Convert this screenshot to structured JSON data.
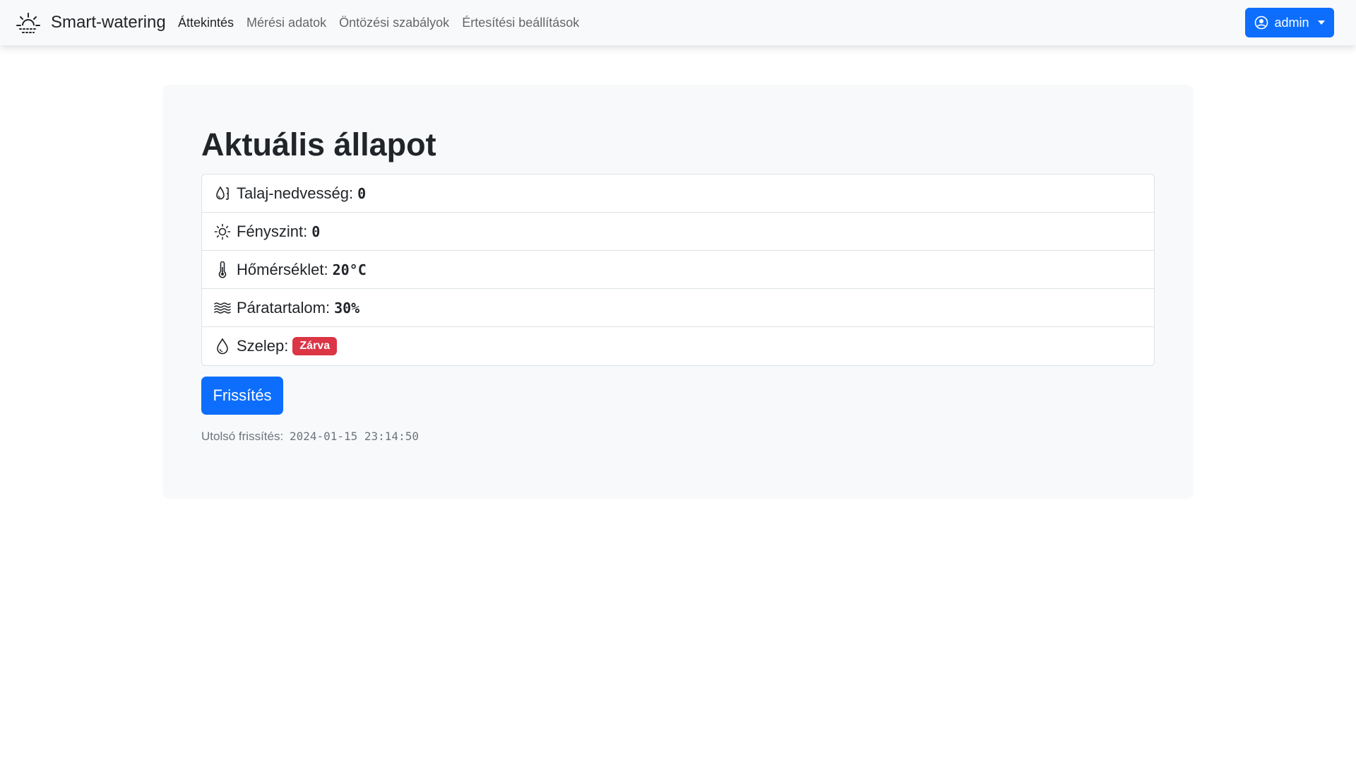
{
  "navbar": {
    "brand": "Smart-watering",
    "brand_icon": "sunrise-icon",
    "links": [
      {
        "label": "Áttekintés",
        "active": true
      },
      {
        "label": "Mérési adatok",
        "active": false
      },
      {
        "label": "Öntözési szabályok",
        "active": false
      },
      {
        "label": "Értesítési beállítások",
        "active": false
      }
    ],
    "user": {
      "label": "admin",
      "icon": "person-circle-icon",
      "color": "#0d6efd"
    }
  },
  "main": {
    "title": "Aktuális állapot",
    "status_items": [
      {
        "icon": "moisture-icon",
        "label": "Talaj-nedvesség:",
        "value": "0"
      },
      {
        "icon": "sun-icon",
        "label": "Fényszint:",
        "value": "0"
      },
      {
        "icon": "thermometer-icon",
        "label": "Hőmérséklet:",
        "value": "20°C"
      },
      {
        "icon": "water-waves-icon",
        "label": "Páratartalom:",
        "value": "30%"
      },
      {
        "icon": "droplet-icon",
        "label": "Szelep:",
        "badge": "Zárva",
        "badge_color": "#dc3545"
      }
    ],
    "refresh_label": "Frissítés",
    "last_update_label": "Utolsó frissítés:",
    "last_update_value": "2024-01-15 23:14:50"
  }
}
